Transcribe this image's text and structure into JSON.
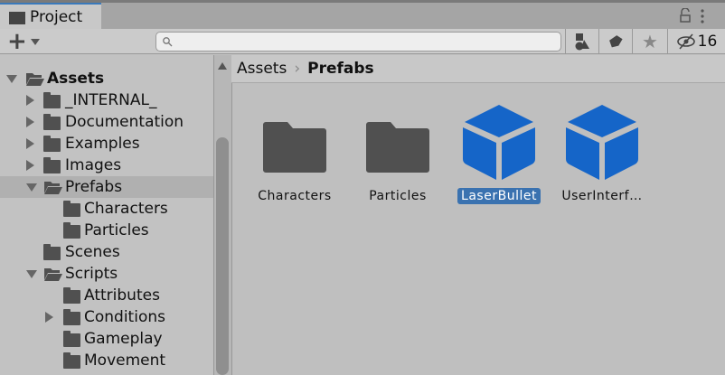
{
  "tab": {
    "title": "Project"
  },
  "toolbar": {
    "add": "+",
    "search_placeholder": "",
    "hidden_count": "16"
  },
  "breadcrumb": {
    "root": "Assets",
    "current": "Prefabs"
  },
  "tree": [
    {
      "label": "Assets",
      "level": 0,
      "arrow": "down",
      "open": true,
      "bold": true
    },
    {
      "label": "_INTERNAL_",
      "level": 1,
      "arrow": "right"
    },
    {
      "label": "Documentation",
      "level": 1,
      "arrow": "right"
    },
    {
      "label": "Examples",
      "level": 1,
      "arrow": "right"
    },
    {
      "label": "Images",
      "level": 1,
      "arrow": "right"
    },
    {
      "label": "Prefabs",
      "level": 1,
      "arrow": "down",
      "open": true,
      "selected": true
    },
    {
      "label": "Characters",
      "level": 2,
      "arrow": ""
    },
    {
      "label": "Particles",
      "level": 2,
      "arrow": ""
    },
    {
      "label": "Scenes",
      "level": 1,
      "arrow": ""
    },
    {
      "label": "Scripts",
      "level": 1,
      "arrow": "down",
      "open": true
    },
    {
      "label": "Attributes",
      "level": 2,
      "arrow": ""
    },
    {
      "label": "Conditions",
      "level": 2,
      "arrow": "right"
    },
    {
      "label": "Gameplay",
      "level": 2,
      "arrow": ""
    },
    {
      "label": "Movement",
      "level": 2,
      "arrow": ""
    }
  ],
  "items": [
    {
      "label": "Characters",
      "type": "folder"
    },
    {
      "label": "Particles",
      "type": "folder"
    },
    {
      "label": "LaserBullet",
      "type": "prefab",
      "selected": true
    },
    {
      "label": "UserInterf…",
      "type": "prefab"
    }
  ],
  "colors": {
    "prefab": "#1565c8",
    "selection": "#3a72b0",
    "tab_accent": "#3a79bb"
  }
}
